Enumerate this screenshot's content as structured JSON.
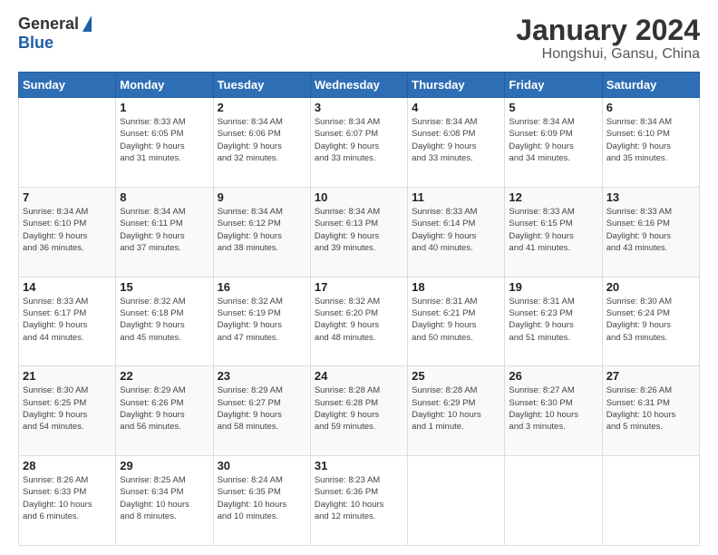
{
  "header": {
    "logo_general": "General",
    "logo_blue": "Blue",
    "month_title": "January 2024",
    "location": "Hongshui, Gansu, China"
  },
  "days_of_week": [
    "Sunday",
    "Monday",
    "Tuesday",
    "Wednesday",
    "Thursday",
    "Friday",
    "Saturday"
  ],
  "weeks": [
    [
      {
        "day": "",
        "info": ""
      },
      {
        "day": "1",
        "info": "Sunrise: 8:33 AM\nSunset: 6:05 PM\nDaylight: 9 hours\nand 31 minutes."
      },
      {
        "day": "2",
        "info": "Sunrise: 8:34 AM\nSunset: 6:06 PM\nDaylight: 9 hours\nand 32 minutes."
      },
      {
        "day": "3",
        "info": "Sunrise: 8:34 AM\nSunset: 6:07 PM\nDaylight: 9 hours\nand 33 minutes."
      },
      {
        "day": "4",
        "info": "Sunrise: 8:34 AM\nSunset: 6:08 PM\nDaylight: 9 hours\nand 33 minutes."
      },
      {
        "day": "5",
        "info": "Sunrise: 8:34 AM\nSunset: 6:09 PM\nDaylight: 9 hours\nand 34 minutes."
      },
      {
        "day": "6",
        "info": "Sunrise: 8:34 AM\nSunset: 6:10 PM\nDaylight: 9 hours\nand 35 minutes."
      }
    ],
    [
      {
        "day": "7",
        "info": "Sunrise: 8:34 AM\nSunset: 6:10 PM\nDaylight: 9 hours\nand 36 minutes."
      },
      {
        "day": "8",
        "info": "Sunrise: 8:34 AM\nSunset: 6:11 PM\nDaylight: 9 hours\nand 37 minutes."
      },
      {
        "day": "9",
        "info": "Sunrise: 8:34 AM\nSunset: 6:12 PM\nDaylight: 9 hours\nand 38 minutes."
      },
      {
        "day": "10",
        "info": "Sunrise: 8:34 AM\nSunset: 6:13 PM\nDaylight: 9 hours\nand 39 minutes."
      },
      {
        "day": "11",
        "info": "Sunrise: 8:33 AM\nSunset: 6:14 PM\nDaylight: 9 hours\nand 40 minutes."
      },
      {
        "day": "12",
        "info": "Sunrise: 8:33 AM\nSunset: 6:15 PM\nDaylight: 9 hours\nand 41 minutes."
      },
      {
        "day": "13",
        "info": "Sunrise: 8:33 AM\nSunset: 6:16 PM\nDaylight: 9 hours\nand 43 minutes."
      }
    ],
    [
      {
        "day": "14",
        "info": "Sunrise: 8:33 AM\nSunset: 6:17 PM\nDaylight: 9 hours\nand 44 minutes."
      },
      {
        "day": "15",
        "info": "Sunrise: 8:32 AM\nSunset: 6:18 PM\nDaylight: 9 hours\nand 45 minutes."
      },
      {
        "day": "16",
        "info": "Sunrise: 8:32 AM\nSunset: 6:19 PM\nDaylight: 9 hours\nand 47 minutes."
      },
      {
        "day": "17",
        "info": "Sunrise: 8:32 AM\nSunset: 6:20 PM\nDaylight: 9 hours\nand 48 minutes."
      },
      {
        "day": "18",
        "info": "Sunrise: 8:31 AM\nSunset: 6:21 PM\nDaylight: 9 hours\nand 50 minutes."
      },
      {
        "day": "19",
        "info": "Sunrise: 8:31 AM\nSunset: 6:23 PM\nDaylight: 9 hours\nand 51 minutes."
      },
      {
        "day": "20",
        "info": "Sunrise: 8:30 AM\nSunset: 6:24 PM\nDaylight: 9 hours\nand 53 minutes."
      }
    ],
    [
      {
        "day": "21",
        "info": "Sunrise: 8:30 AM\nSunset: 6:25 PM\nDaylight: 9 hours\nand 54 minutes."
      },
      {
        "day": "22",
        "info": "Sunrise: 8:29 AM\nSunset: 6:26 PM\nDaylight: 9 hours\nand 56 minutes."
      },
      {
        "day": "23",
        "info": "Sunrise: 8:29 AM\nSunset: 6:27 PM\nDaylight: 9 hours\nand 58 minutes."
      },
      {
        "day": "24",
        "info": "Sunrise: 8:28 AM\nSunset: 6:28 PM\nDaylight: 9 hours\nand 59 minutes."
      },
      {
        "day": "25",
        "info": "Sunrise: 8:28 AM\nSunset: 6:29 PM\nDaylight: 10 hours\nand 1 minute."
      },
      {
        "day": "26",
        "info": "Sunrise: 8:27 AM\nSunset: 6:30 PM\nDaylight: 10 hours\nand 3 minutes."
      },
      {
        "day": "27",
        "info": "Sunrise: 8:26 AM\nSunset: 6:31 PM\nDaylight: 10 hours\nand 5 minutes."
      }
    ],
    [
      {
        "day": "28",
        "info": "Sunrise: 8:26 AM\nSunset: 6:33 PM\nDaylight: 10 hours\nand 6 minutes."
      },
      {
        "day": "29",
        "info": "Sunrise: 8:25 AM\nSunset: 6:34 PM\nDaylight: 10 hours\nand 8 minutes."
      },
      {
        "day": "30",
        "info": "Sunrise: 8:24 AM\nSunset: 6:35 PM\nDaylight: 10 hours\nand 10 minutes."
      },
      {
        "day": "31",
        "info": "Sunrise: 8:23 AM\nSunset: 6:36 PM\nDaylight: 10 hours\nand 12 minutes."
      },
      {
        "day": "",
        "info": ""
      },
      {
        "day": "",
        "info": ""
      },
      {
        "day": "",
        "info": ""
      }
    ]
  ]
}
